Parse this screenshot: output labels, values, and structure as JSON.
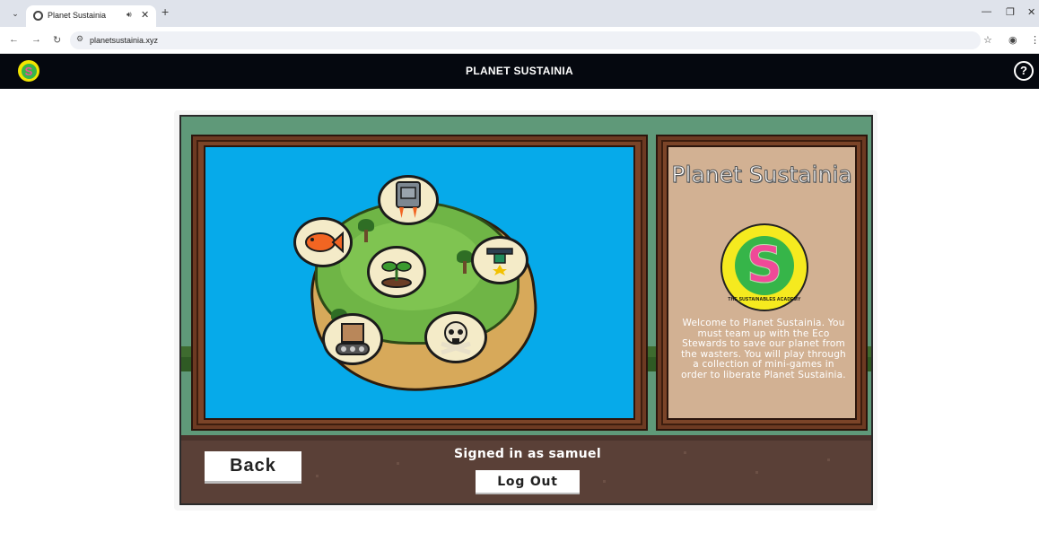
{
  "browser": {
    "tab_title": "Planet Sustainia",
    "url": "planetsustainia.xyz",
    "icons": [
      "tab-menu-icon",
      "globe-icon",
      "speaker-icon",
      "close-icon",
      "plus-icon",
      "minimize-icon",
      "restore-icon",
      "back-icon",
      "forward-icon",
      "reload-icon",
      "site-info-icon",
      "star-icon",
      "profile-icon",
      "menu-dots-icon"
    ]
  },
  "header": {
    "title": "PLANET SUSTAINIA",
    "logo_letter": "S",
    "help_label": "?"
  },
  "map": {
    "nodes": [
      "fish",
      "jetpack",
      "seedling",
      "drone",
      "cardboard-box-conveyor",
      "skull-crossbones"
    ]
  },
  "info": {
    "title": "Planet Sustainia",
    "logo_letter": "S",
    "logo_ring_text": "THE SUSTAINABLES ACADEMY",
    "description": "Welcome to Planet Sustainia. You must team up with the Eco Stewards to save our planet from the wasters. You will play through a collection of mini-games in order to liberate Planet Sustainia."
  },
  "controls": {
    "back_label": "Back",
    "signed_in_text": "Signed in as samuel",
    "logout_label": "Log Out"
  },
  "colors": {
    "header_bg": "#05080f",
    "sea": "#06aaea",
    "game_bg": "#5f9979",
    "frame_wood": "#6d3a22",
    "info_card": "#d2b193",
    "logo_yellow": "#f5ea1f",
    "logo_green": "#36b549",
    "logo_pink": "#f04a98"
  }
}
